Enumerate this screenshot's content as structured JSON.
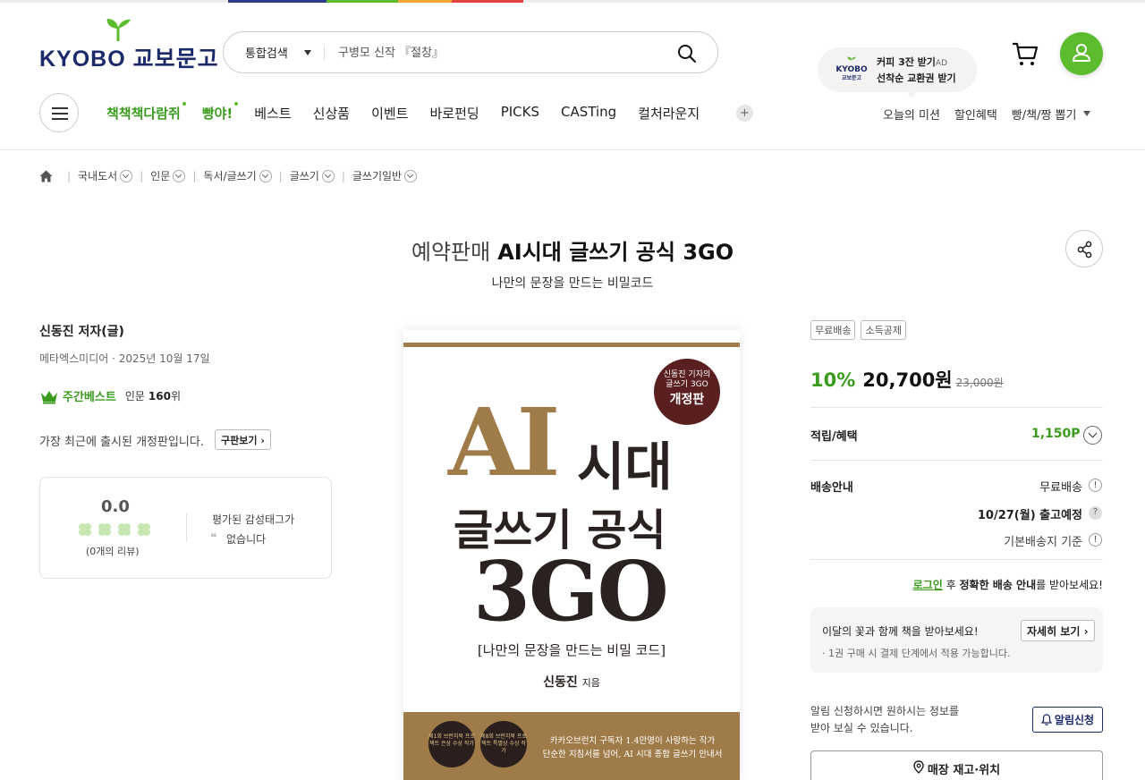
{
  "header": {
    "logo_text": "KYOBO 교보문고",
    "search": {
      "category": "통합검색",
      "placeholder": "구병모 신작 『절창』"
    },
    "ad": {
      "logo_line1": "KYOBO",
      "logo_line2": "교보문고",
      "line1": "커피 3잔 받기",
      "ad_mark": "AD",
      "line2": "선착순 교환권 받기"
    },
    "nav": [
      "책책책다람쥐",
      "빵야!",
      "베스트",
      "신상품",
      "이벤트",
      "바로펀딩",
      "PICKS",
      "CASTing",
      "컬처라운지"
    ],
    "nav_plus": "+",
    "util_nav": [
      "오늘의 미션",
      "할인혜택",
      "빵/책/짱 뽑기"
    ]
  },
  "breadcrumb": [
    "국내도서",
    "인문",
    "독서/글쓰기",
    "글쓰기",
    "글쓰기일반"
  ],
  "product": {
    "badge": "예약판매",
    "title": "AI시대 글쓰기 공식 3GO",
    "subtitle": "나만의 문장을 만드는 비밀코드",
    "author": "신동진 저자(글)",
    "pub_info": "메타엑스미디어 · 2025년 10월 17일",
    "best": {
      "label": "주간베스트",
      "category": "인문",
      "rank": "160",
      "unit": "위"
    },
    "edition_note": "가장 최근에 출시된 개정판입니다.",
    "old_edition_button": "구판보기",
    "review": {
      "score": "0.0",
      "count_text": "(0개의 리뷰)",
      "tag_line1": "평가된 감성태그가",
      "tag_line2": "없습니다",
      "quote_mark": "❝"
    }
  },
  "cover": {
    "badge_line1": "신동진 기자의",
    "badge_line2": "글쓰기 3GO",
    "badge_line3": "개정판",
    "ai": "AI",
    "sidae": "시대",
    "geul": "글쓰기 공식",
    "go": "3GO",
    "sub": "[나만의 문장을 만드는 비밀 코드]",
    "author": "신동진",
    "author_suffix": "지음",
    "medal1": "제1회 브런치북 프로젝트 은상 수상 작가",
    "medal2": "제8회 브런치북 프로젝트 특별상 수상 작가",
    "band_line1": "카카오브런치 구독자 1.4만명이 사랑하는 작가",
    "band_line2": "단순한 지침서를 넘어, AI 시대 종합 글쓰기 안내서"
  },
  "purchase": {
    "tags": [
      "무료배송",
      "소득공제"
    ],
    "discount": "10%",
    "price": "20,700원",
    "original_price": "23,000원",
    "points_label": "적립/혜택",
    "points_value": "1,150P",
    "delivery_label": "배송안내",
    "delivery_free": "무료배송",
    "delivery_date": "10/27(월) 출고예정",
    "delivery_base": "기본배송지 기준",
    "login_link": "로그인",
    "login_after": "후",
    "login_bold": "정확한 배송 안내",
    "login_tail": "를 받아보세요!",
    "flower_title": "이달의 꽃과 함께 책을 받아보세요!",
    "flower_detail": "· 1권 구매 시 결제 단계에서 적용 가능합니다.",
    "flower_button": "자세히 보기",
    "alarm_line1": "알림 신청하시면 원하시는 정보를",
    "alarm_line2": "받아 보실 수 있습니다.",
    "alarm_button": "알림신청",
    "store_button": "매장 재고·위치"
  },
  "colors": {
    "brand_green": "#5dbb2e",
    "price_green": "#3a9b1f",
    "brand_navy": "#1b2a6b",
    "cover_gold": "#a07b4a"
  }
}
